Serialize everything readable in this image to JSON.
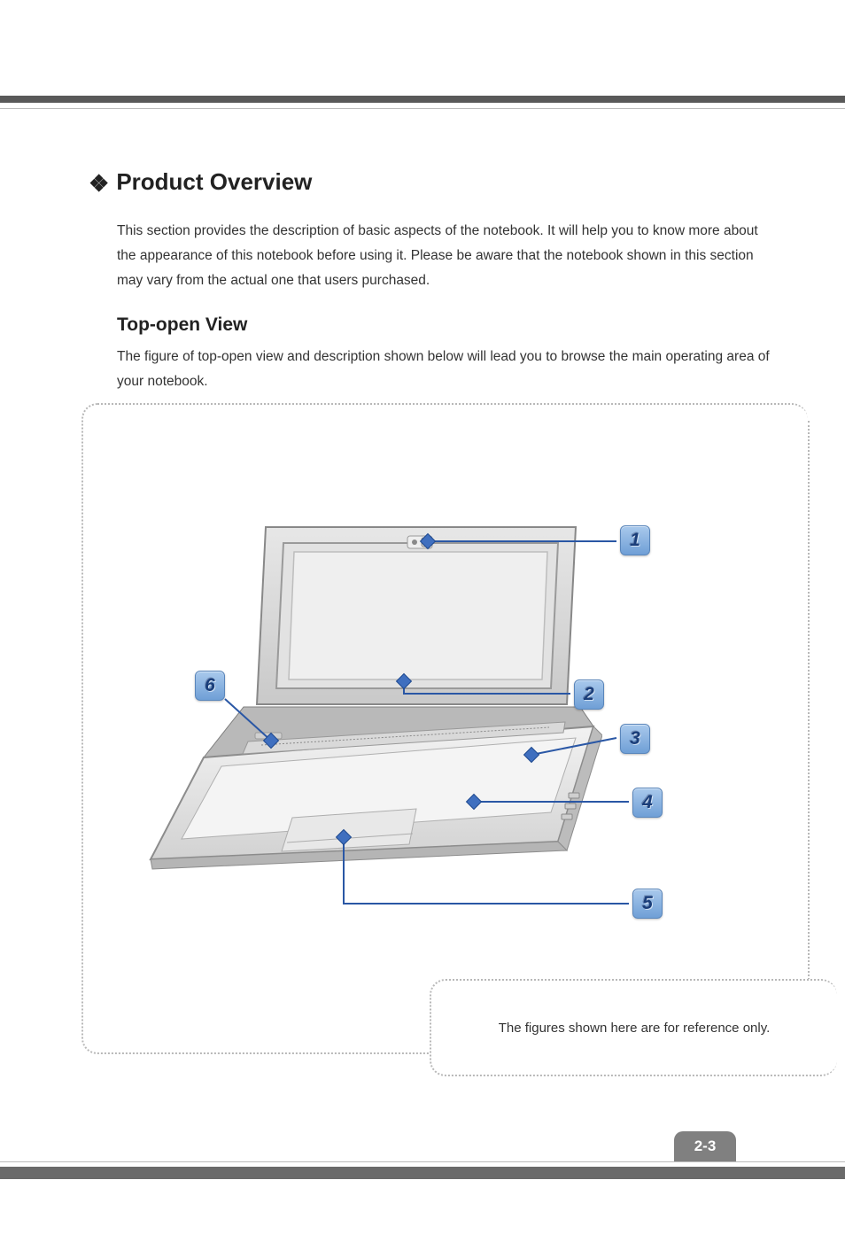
{
  "heading": "Product Overview",
  "intro": "This section provides the description of basic aspects of the notebook.   It will help you to know more about the appearance of this notebook before using it. Please be aware that the notebook shown in this section may vary from the actual one that users purchased.",
  "subheading": "Top-open View",
  "subintro": "The figure of top-open view and description shown below will lead you to browse the main operating area of your notebook.",
  "note": "The figures shown here are for reference only.",
  "page_number": "2-3",
  "callouts": {
    "c1": "1",
    "c2": "2",
    "c3": "3",
    "c4": "4",
    "c5": "5",
    "c6": "6"
  },
  "callout_colors": {
    "line": "#2a57a5",
    "marker_fill": "#3f6fbf",
    "marker_stroke": "#1f4a90"
  }
}
